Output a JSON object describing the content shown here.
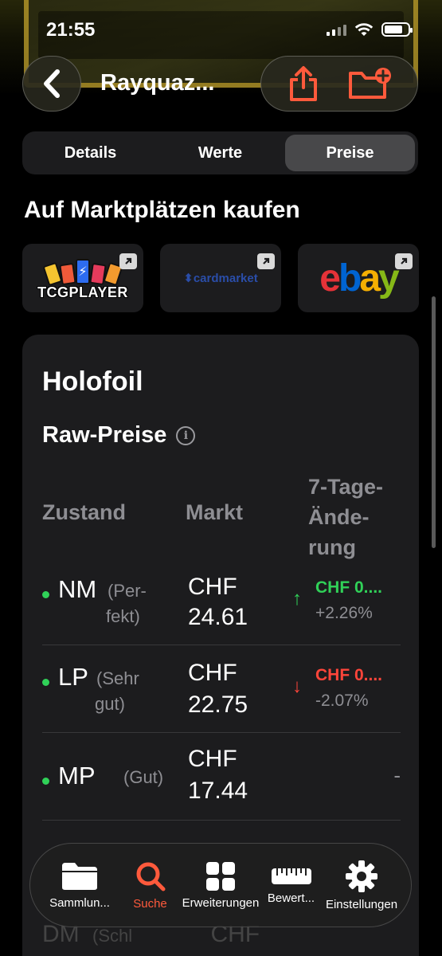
{
  "status": {
    "time": "21:55"
  },
  "nav": {
    "title": "Rayquaz..."
  },
  "segments": [
    {
      "label": "Details",
      "active": false
    },
    {
      "label": "Werte",
      "active": false
    },
    {
      "label": "Preise",
      "active": true
    }
  ],
  "marketplaces": {
    "title": "Auf Marktplätzen kaufen",
    "items": [
      {
        "name": "TCGPLAYER",
        "icon": "tcgplayer-logo"
      },
      {
        "name": "cardmarket",
        "icon": "cardmarket-logo"
      },
      {
        "name": "ebay",
        "icon": "ebay-logo"
      }
    ]
  },
  "prices": {
    "variant": "Holofoil",
    "section": "Raw-Preise",
    "headers": {
      "condition": "Zustand",
      "market": "Markt",
      "change": "7-Tage-Änderung"
    },
    "change_header_lines": [
      "7-Tage-",
      "Ände-",
      "rung"
    ],
    "rows": [
      {
        "code": "NM",
        "quality_lines": [
          "(Per-",
          "fekt)"
        ],
        "currency": "CHF",
        "amount": "24.61",
        "direction": "up",
        "change": "CHF 0....",
        "pct": "+2.26%"
      },
      {
        "code": "LP",
        "quality_lines": [
          "(Sehr",
          "gut)"
        ],
        "currency": "CHF",
        "amount": "22.75",
        "direction": "down",
        "change": "CHF 0....",
        "pct": "-2.07%"
      },
      {
        "code": "MP",
        "quality": "(Gut)",
        "currency": "CHF",
        "amount": "17.44",
        "direction": "none",
        "change": "-"
      }
    ],
    "peek_row": {
      "code": "DM",
      "quality": "(Schl",
      "currency": "CHF"
    }
  },
  "tabbar": {
    "items": [
      {
        "label": "Sammlun...",
        "icon": "folder-icon",
        "active": false
      },
      {
        "label": "Suche",
        "icon": "search-icon",
        "active": true
      },
      {
        "label": "Erweiterungen",
        "icon": "grid-icon",
        "active": false
      },
      {
        "label": "Bewert...",
        "icon": "ruler-icon",
        "active": false
      },
      {
        "label": "Einstellungen",
        "icon": "gear-icon",
        "active": false
      }
    ]
  },
  "colors": {
    "accent": "#ff5a3c",
    "up": "#30d158",
    "down": "#ff453a",
    "panel": "#1c1c1e",
    "muted": "#8e8e93"
  }
}
